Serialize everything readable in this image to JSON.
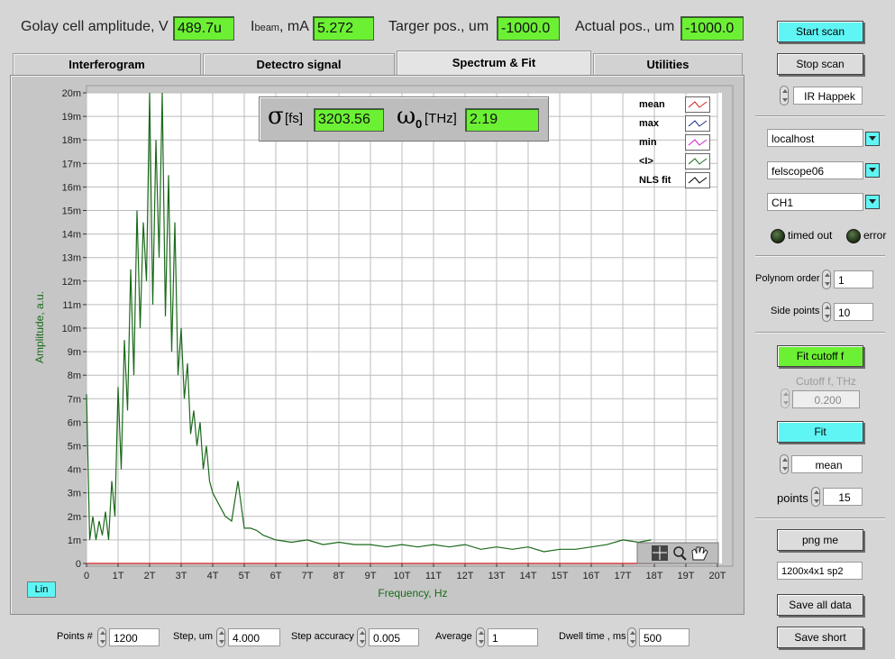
{
  "indicators": {
    "golay": {
      "label": "Golay cell amplitude, V",
      "value": "489.7u"
    },
    "ibeam": {
      "label_main": "I",
      "label_sub": "beam",
      "label_unit": ", mA",
      "value": "5.272"
    },
    "target": {
      "label": "Targer pos., um",
      "value": "-1000.0"
    },
    "actual": {
      "label": "Actual pos., um",
      "value": "-1000.0"
    }
  },
  "tabs": [
    {
      "label": "Interferogram"
    },
    {
      "label": "Detectro signal"
    },
    {
      "label": "Spectrum & Fit"
    },
    {
      "label": "Utilities"
    }
  ],
  "fit_results": {
    "sigma": {
      "symbol": "σ",
      "unit": "[fs]",
      "value": "3203.56"
    },
    "omega": {
      "symbol": "ω",
      "sub": "0",
      "unit": "[THz]",
      "value": "2.19"
    }
  },
  "legend": [
    {
      "name": "mean",
      "color": "#d02020"
    },
    {
      "name": "max",
      "color": "#203080"
    },
    {
      "name": "min",
      "color": "#d020d0"
    },
    {
      "name": "<I>",
      "color": "#1a6a1a"
    },
    {
      "name": "NLS fit",
      "color": "#000000"
    }
  ],
  "chart_data": {
    "type": "line",
    "xlabel": "Frequency, Hz",
    "ylabel": "Amplitude, a.u.",
    "xlim": [
      0,
      20
    ],
    "ylim": [
      0,
      20
    ],
    "x_ticks": [
      "0",
      "1T",
      "2T",
      "3T",
      "4T",
      "5T",
      "6T",
      "7T",
      "8T",
      "9T",
      "10T",
      "11T",
      "12T",
      "13T",
      "14T",
      "15T",
      "16T",
      "17T",
      "18T",
      "19T",
      "20T"
    ],
    "y_ticks": [
      "0",
      "1m",
      "2m",
      "3m",
      "4m",
      "5m",
      "6m",
      "7m",
      "8m",
      "9m",
      "10m",
      "11m",
      "12m",
      "13m",
      "14m",
      "15m",
      "16m",
      "17m",
      "18m",
      "19m",
      "20m"
    ],
    "grid": true,
    "scale_button": "Lin",
    "series": [
      {
        "name": "<I>",
        "color": "#1a6a1a",
        "x": [
          0,
          0.05,
          0.1,
          0.2,
          0.3,
          0.4,
          0.5,
          0.6,
          0.7,
          0.8,
          0.9,
          1.0,
          1.1,
          1.2,
          1.3,
          1.4,
          1.5,
          1.6,
          1.7,
          1.8,
          1.9,
          2.0,
          2.1,
          2.2,
          2.3,
          2.4,
          2.5,
          2.6,
          2.7,
          2.8,
          2.9,
          3.0,
          3.1,
          3.2,
          3.3,
          3.4,
          3.5,
          3.6,
          3.7,
          3.8,
          3.9,
          4.0,
          4.2,
          4.4,
          4.6,
          4.8,
          5.0,
          5.2,
          5.4,
          5.6,
          5.8,
          6.0,
          6.5,
          7.0,
          7.5,
          8.0,
          8.5,
          9.0,
          9.5,
          10.0,
          10.5,
          11.0,
          11.5,
          12.0,
          12.5,
          13.0,
          13.5,
          14.0,
          14.5,
          15.0,
          15.5,
          16.0,
          16.5,
          17.0,
          17.5,
          17.9
        ],
        "y": [
          7.2,
          4.0,
          1.0,
          2.0,
          1.0,
          1.8,
          1.2,
          2.2,
          1.0,
          3.5,
          2.0,
          7.5,
          4.0,
          9.5,
          6.5,
          12.5,
          8.0,
          15.0,
          10.0,
          14.5,
          12.0,
          20.0,
          11.0,
          18.0,
          13.0,
          20.0,
          10.5,
          16.5,
          9.0,
          14.5,
          8.0,
          10.0,
          7.0,
          8.5,
          5.5,
          6.5,
          5.0,
          6.0,
          4.0,
          5.0,
          3.5,
          3.0,
          2.5,
          2.0,
          1.8,
          3.5,
          1.5,
          1.5,
          1.4,
          1.2,
          1.1,
          1.0,
          0.9,
          1.0,
          0.8,
          0.9,
          0.8,
          0.8,
          0.7,
          0.8,
          0.7,
          0.8,
          0.7,
          0.8,
          0.6,
          0.7,
          0.6,
          0.7,
          0.5,
          0.6,
          0.6,
          0.7,
          0.8,
          1.0,
          0.9,
          1.0
        ]
      },
      {
        "name": "mean",
        "color": "#d02020",
        "x": [
          0,
          17.9
        ],
        "y": [
          0,
          0
        ]
      }
    ]
  },
  "right_panel": {
    "start_scan": "Start scan",
    "stop_scan": "Stop scan",
    "ir_source": "IR Happek",
    "host": "localhost",
    "scope": "felscope06",
    "channel": "CH1",
    "timed_out": "timed out",
    "error": "error",
    "polynom_label": "Polynom order",
    "polynom_value": "1",
    "side_label": "Side points",
    "side_value": "10",
    "fit_cutoff": "Fit cutoff f",
    "cutoff_label": "Cutoff f, THz",
    "cutoff_value": "0.200",
    "fit": "Fit",
    "fit_mode": "mean",
    "points_label": "points",
    "points_value": "15",
    "png": "png me",
    "file_label": "1200x4x1 sp2",
    "save_all": "Save all data",
    "save_short": "Save short"
  },
  "bottom": {
    "points": {
      "label": "Points #",
      "value": "1200"
    },
    "step": {
      "label": "Step, um",
      "value": "4.000"
    },
    "accuracy": {
      "label": "Step accuracy",
      "value": "0.005"
    },
    "average": {
      "label": "Average",
      "value": "1"
    },
    "dwell": {
      "label": "Dwell time , ms",
      "value": "500"
    }
  }
}
